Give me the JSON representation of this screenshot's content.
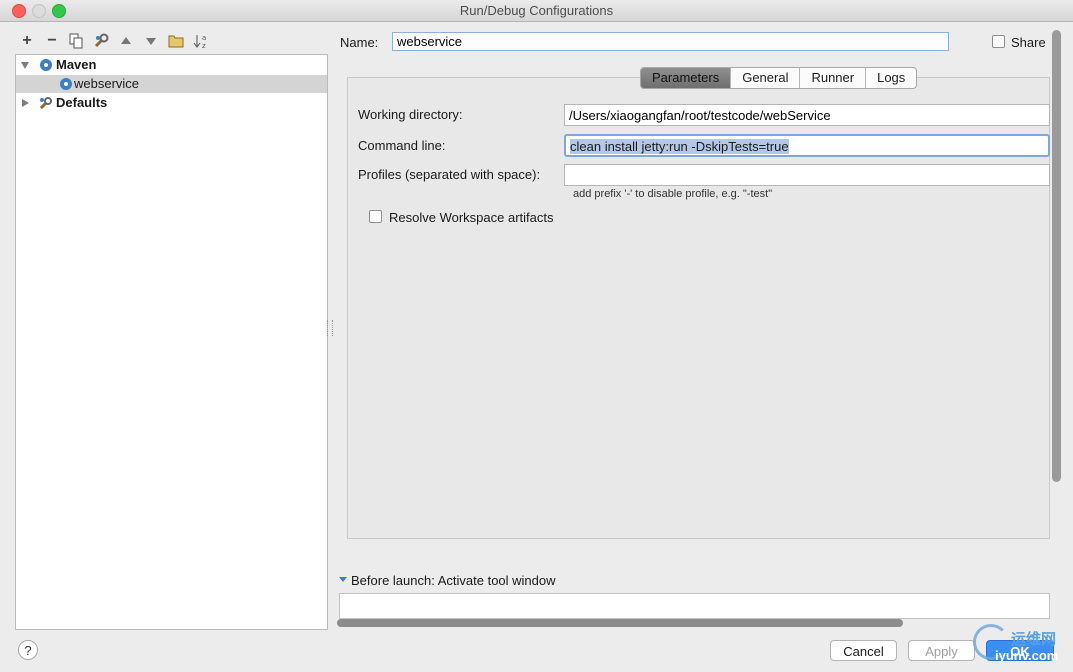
{
  "window": {
    "title": "Run/Debug Configurations"
  },
  "toolbar": {
    "buttons": [
      {
        "name": "add-button",
        "icon": "plus-icon",
        "glyph": "+"
      },
      {
        "name": "remove-button",
        "icon": "minus-icon",
        "glyph": "−"
      },
      {
        "name": "copy-button",
        "icon": "copy-icon",
        "glyph": "⧉"
      },
      {
        "name": "edit-defaults-button",
        "icon": "wrench-icon",
        "glyph": "⚒"
      },
      {
        "name": "move-up-button",
        "icon": "triangle-up-icon",
        "glyph": "▲"
      },
      {
        "name": "move-down-button",
        "icon": "triangle-down-icon",
        "glyph": "▼"
      },
      {
        "name": "folder-button",
        "icon": "folder-icon",
        "glyph": "▭"
      },
      {
        "name": "sort-button",
        "icon": "sort-az-icon",
        "glyph": "↓ᶻ"
      }
    ]
  },
  "tree": {
    "maven_label": "Maven",
    "webservice_label": "webservice",
    "defaults_label": "Defaults"
  },
  "form": {
    "name_label": "Name:",
    "name_value": "webservice",
    "share_label": "Share"
  },
  "tabs": [
    "Parameters",
    "General",
    "Runner",
    "Logs"
  ],
  "parameters": {
    "working_dir_label": "Working directory:",
    "working_dir_value": "/Users/xiaogangfan/root/testcode/webService",
    "command_line_label": "Command line:",
    "command_line_value": "clean install jetty:run -DskipTests=true",
    "profiles_label": "Profiles (separated with space):",
    "profiles_value": "",
    "profiles_hint": "add prefix '-' to disable profile, e.g. \"-test\"",
    "resolve_label": "Resolve Workspace artifacts"
  },
  "before_launch": {
    "label": "Before launch: Activate tool window"
  },
  "buttons": {
    "help": "?",
    "cancel": "Cancel",
    "apply": "Apply",
    "ok": "OK"
  },
  "watermark": {
    "text": "运维网",
    "subtext": "iyunv.com"
  },
  "colors": {
    "selection": "#b3c8e6",
    "ok_button": "#3c8ef3",
    "accent": "#3d7fc7"
  }
}
